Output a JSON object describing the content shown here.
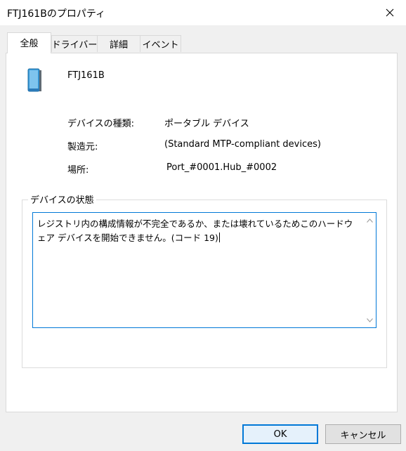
{
  "window": {
    "title": "FTJ161Bのプロパティ"
  },
  "tabs": [
    {
      "label": "全般",
      "active": true
    },
    {
      "label": "ドライバー",
      "active": false
    },
    {
      "label": "詳細",
      "active": false
    },
    {
      "label": "イベント",
      "active": false
    }
  ],
  "device": {
    "name": "FTJ161B",
    "icon": "portable-device-icon"
  },
  "properties": [
    {
      "label": "デバイスの種類:",
      "value": "ポータブル デバイス"
    },
    {
      "label": "製造元:",
      "value": "(Standard MTP-compliant devices)"
    },
    {
      "label": "場所:",
      "value": "Port_#0001.Hub_#0002"
    }
  ],
  "status_group": {
    "legend": "デバイスの状態",
    "text": "レジストリ内の構成情報が不完全であるか、または壊れているためこのハードウェア デバイスを開始できません。(コード 19)"
  },
  "buttons": {
    "ok": "OK",
    "cancel": "キャンセル"
  },
  "colors": {
    "accent": "#0078d7",
    "dialog_bg": "#f0f0f0"
  }
}
